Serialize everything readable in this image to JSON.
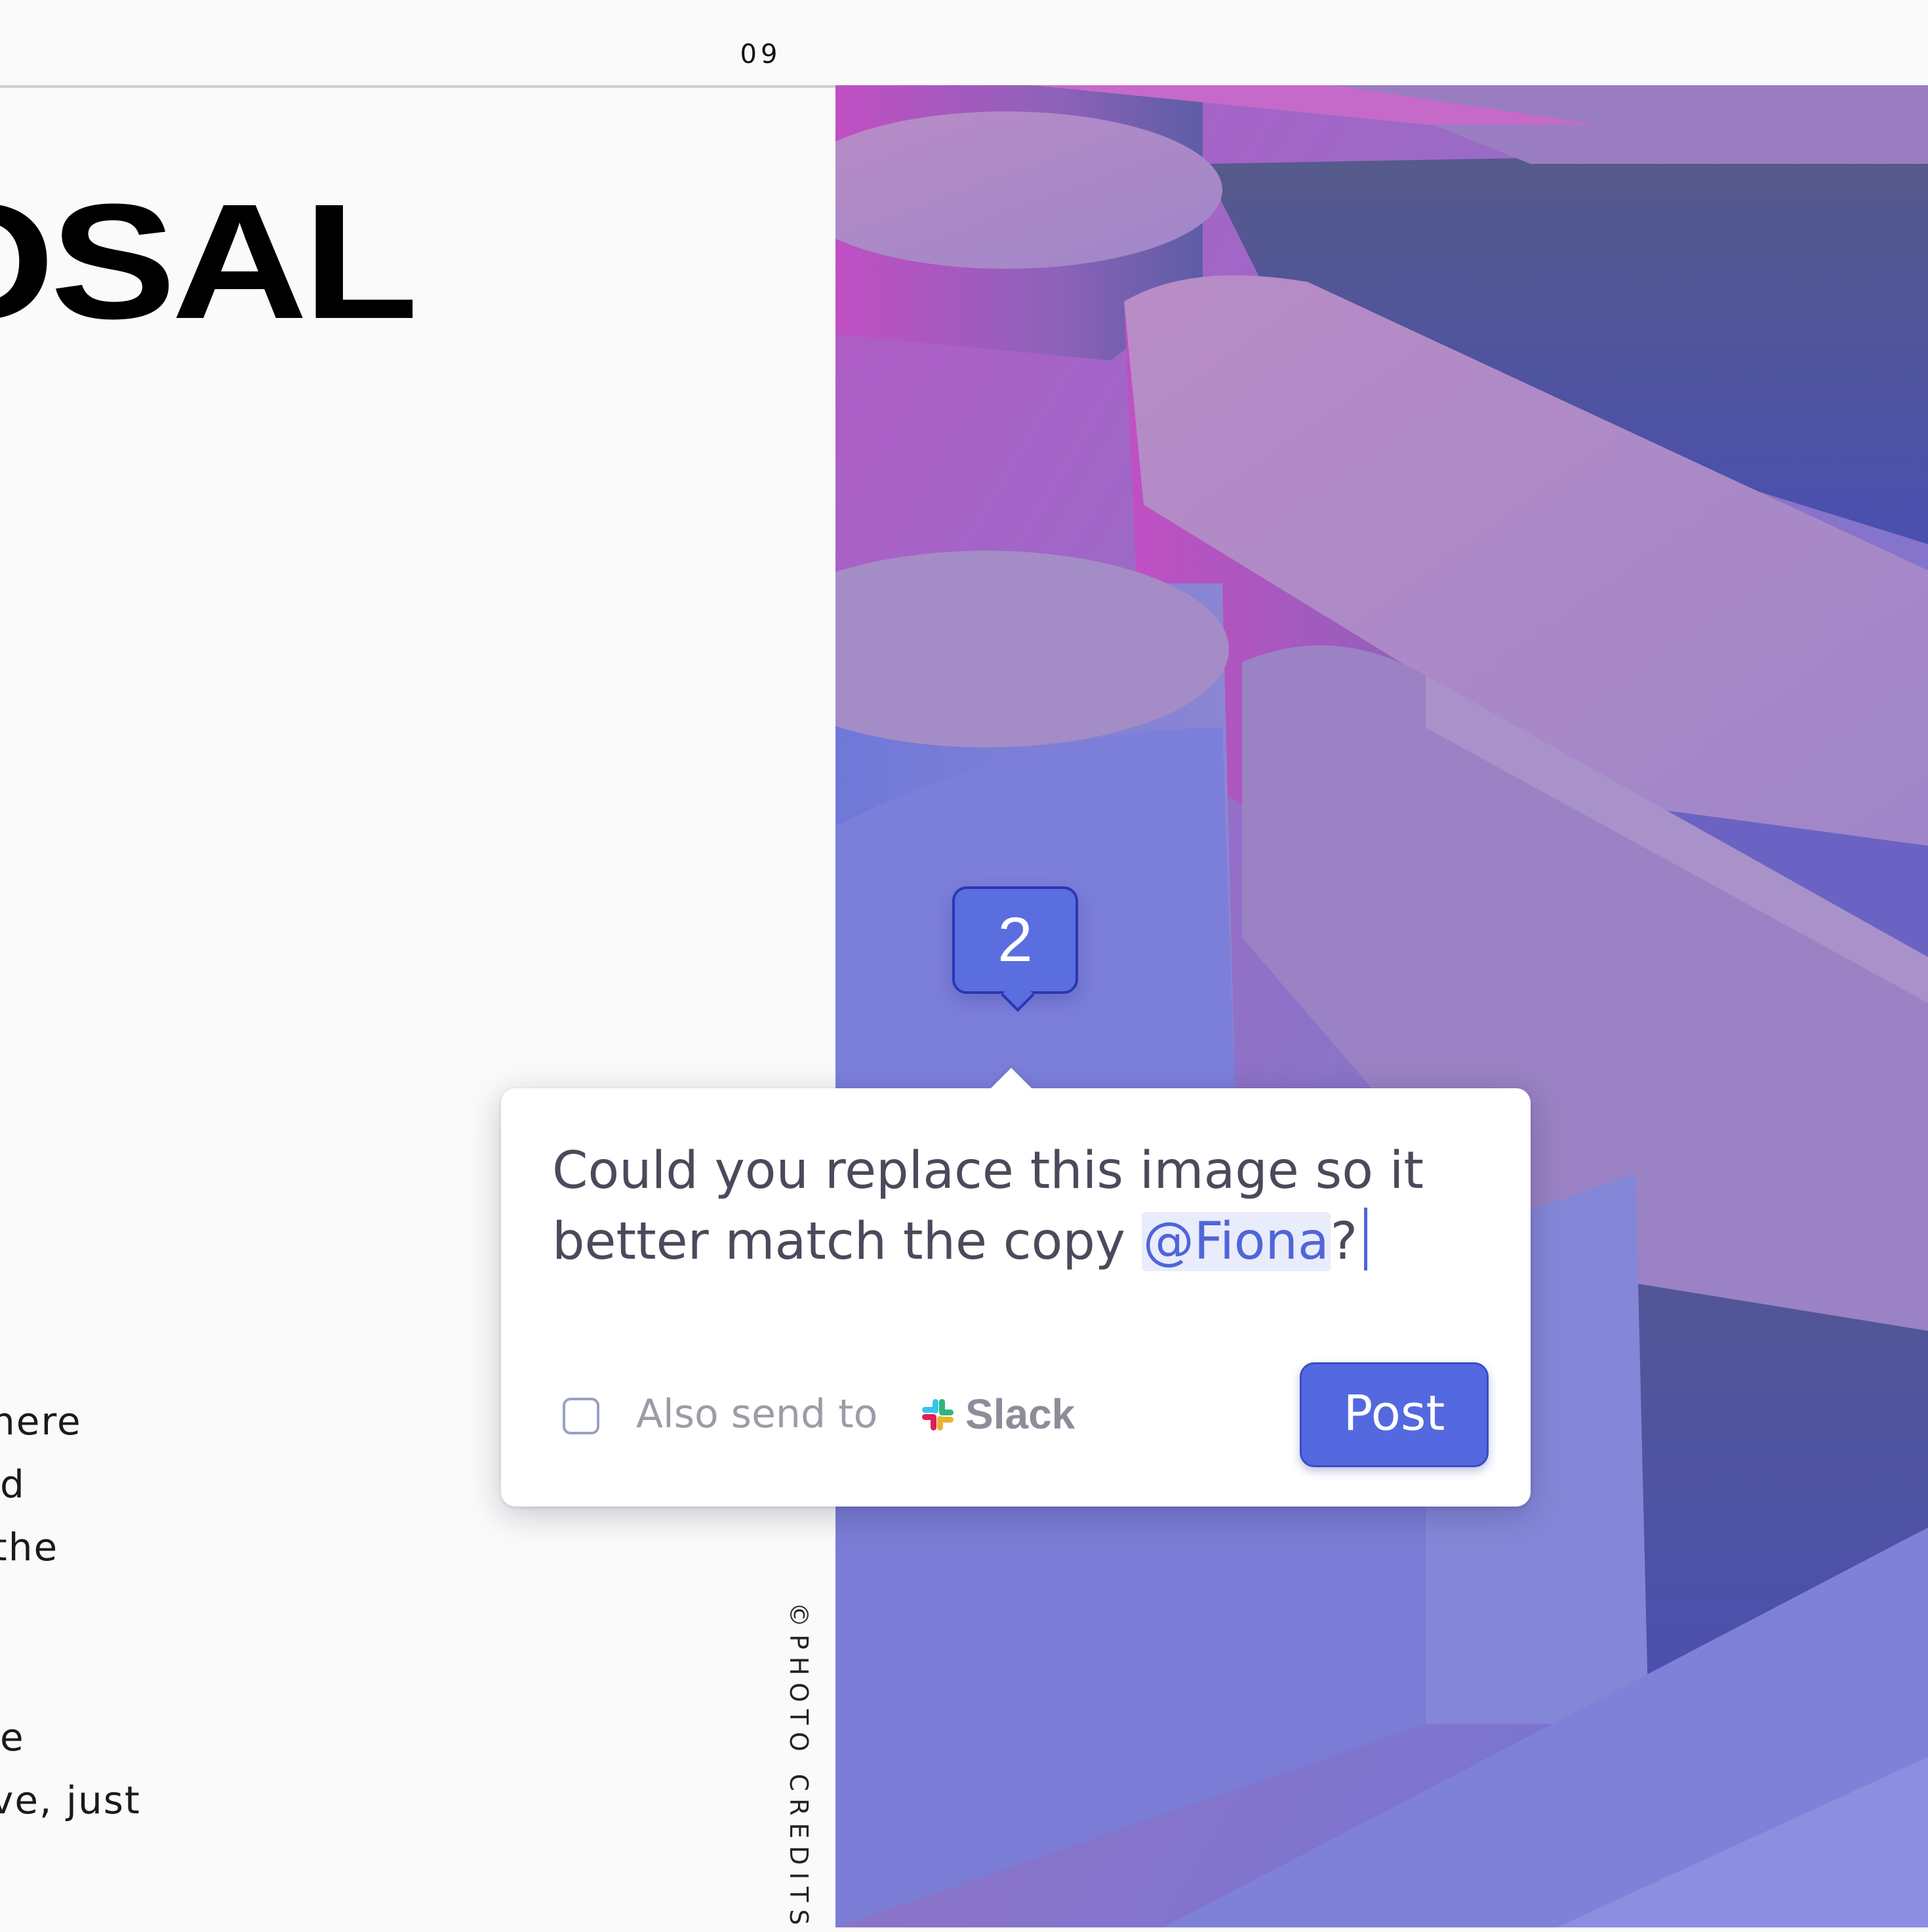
{
  "header": {
    "page_number": "09"
  },
  "document": {
    "title": "OSAL",
    "body_lines": [
      "here",
      "d",
      "the",
      "e",
      "ve, just"
    ],
    "photo_credits": "©PHOTO CREDITS"
  },
  "comment": {
    "pin_number": "2",
    "text_before": "Could you replace this image so it better match the copy ",
    "mention": "@Fiona",
    "text_after": "?",
    "also_send_label": "Also send to",
    "slack_label": "Slack",
    "post_label": "Post"
  },
  "colors": {
    "accent": "#5469e0",
    "mention_bg": "#e9ecfb",
    "slack_colors": [
      "#36c5f0",
      "#2eb67d",
      "#ecb22e",
      "#e01e5a"
    ]
  },
  "icons": [
    "slack-icon",
    "checkbox-icon"
  ]
}
